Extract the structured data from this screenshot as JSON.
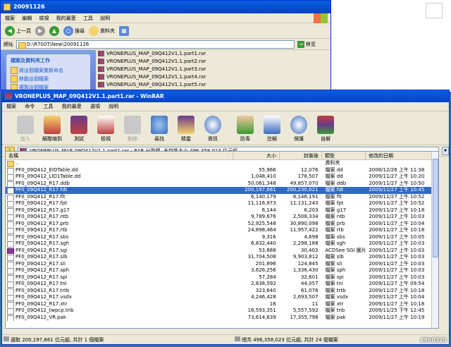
{
  "explorer": {
    "title": "20091126",
    "menu": [
      "檔案",
      "編輯",
      "檢視",
      "我的最愛",
      "工具",
      "說明"
    ],
    "back_label": "上一頁",
    "search_label": "搜尋",
    "folders_label": "資料夾",
    "address_label": "網址",
    "address": "D:\\R700T\\New\\20091126",
    "go_label": "移至",
    "task_title": "檔案及資料夾工作",
    "tasks": [
      "將這個檔案重新命名",
      "移動這個檔案",
      "複製這個檔案"
    ],
    "files": [
      "VRONEPLUS_MAP_09Q412V1.1.part1.rar",
      "VRONEPLUS_MAP_09Q412V1.1.part2.rar",
      "VRONEPLUS_MAP_09Q412V1.1.part3.rar",
      "VRONEPLUS_MAP_09Q412V1.1.part4.rar",
      "VRONEPLUS_MAP_09Q412V1.1.part5.rar"
    ]
  },
  "winrar": {
    "title": "VRONEPLUS_MAP_09Q412V1.1.part1.rar - WinRAR",
    "menu": [
      "檔案",
      "命令",
      "工具",
      "我的最愛",
      "選項",
      "說明"
    ],
    "toolbar": [
      "加入",
      "解壓縮到",
      "測試",
      "檢視",
      "刪除",
      "尋找",
      "精靈",
      "資訊",
      "防毒",
      "註解",
      "保護",
      "自解"
    ],
    "path": "VRONEPLUS_MAP_09Q412V1.1.part1.rar - RAR 分割檔, 未封裝大小 496,358,023 位元組",
    "columns": [
      "名稱",
      "大小",
      "封裝後",
      "類型",
      "修改的日期"
    ],
    "rows": [
      [
        "..",
        "",
        "",
        "資料夾",
        ""
      ],
      [
        "PF0_09Q412_EIDTable.dd",
        "55,966",
        "12,076",
        "檔案 dd",
        "2008/12/26 上午 11:38"
      ],
      [
        "PF0_09Q412_LID1Table.dd",
        "1,048,410",
        "178,507",
        "檔案 dd",
        "2009/11/27 上午 10:20"
      ],
      [
        "PF0_09Q412_R17.ddb",
        "50,061,348",
        "49,857,070",
        "檔案 ddb",
        "2009/11/27 上午 10:50"
      ],
      [
        "PF0_09Q412_R17.fdt",
        "200,197,661",
        "200,230,621",
        "檔案 fdt",
        "2009/11/27 上午 10:45"
      ],
      [
        "PF0_09Q412_R17.flt",
        "6,140,179",
        "6,146,191",
        "檔案 flt",
        "2009/11/27 上午 10:52"
      ],
      [
        "PF0_09Q412_R17.fpt",
        "11,116,973",
        "11,131,243",
        "檔案 fpt",
        "2009/11/27 上午 10:52"
      ],
      [
        "PF0_09Q412_R17.g17",
        "6,144",
        "6,203",
        "檔案 g17",
        "2009/11/27 上午 10:18"
      ],
      [
        "PF0_09Q412_R17.ntb",
        "9,789,676",
        "2,508,334",
        "檔案 ntb",
        "2009/11/27 上午 10:03"
      ],
      [
        "PF0_09Q412_R17.prb",
        "52,925,548",
        "30,890,098",
        "檔案 prb",
        "2009/11/27 上午 10:04"
      ],
      [
        "PF0_09Q412_R17.rtb",
        "24,898,464",
        "11,957,422",
        "檔案 rtb",
        "2009/11/27 上午 10:18"
      ],
      [
        "PF0_09Q412_R17.sbs",
        "9,316",
        "4,698",
        "檔案 sbs",
        "2009/11/27 上午 10:05"
      ],
      [
        "PF0_09Q412_R17.sgh",
        "6,832,440",
        "2,298,188",
        "檔案 sgh",
        "2009/11/27 上午 10:03"
      ],
      [
        "PF0_09Q412_R17.sgi",
        "53,888",
        "30,403",
        "ACDSee SGI 圖片",
        "2009/11/27 上午 10:03"
      ],
      [
        "PF0_09Q412_R17.slb",
        "31,704,508",
        "9,903,812",
        "檔案 slb",
        "2009/11/27 上午 10:03"
      ],
      [
        "PF0_09Q412_R17.sli",
        "201,896",
        "124,845",
        "檔案 sli",
        "2009/11/27 上午 10:03"
      ],
      [
        "PF0_09Q412_R17.sph",
        "3,626,256",
        "1,336,430",
        "檔案 sph",
        "2009/11/27 上午 10:03"
      ],
      [
        "PF0_09Q412_R17.spi",
        "57,284",
        "32,601",
        "檔案 spi",
        "2009/11/27 上午 10:03"
      ],
      [
        "PF0_09Q412_R17.tni",
        "2,838,592",
        "44,057",
        "檔案 tni",
        "2009/11/27 上午 09:54"
      ],
      [
        "PF0_09Q412_R17.trtb",
        "323,640",
        "61,076",
        "檔案 trtb",
        "2009/11/27 上午 10:18"
      ],
      [
        "PF0_09Q412_R17.vsdx",
        "4,246,428",
        "2,693,507",
        "檔案 vsdx",
        "2009/11/27 上午 10:04"
      ],
      [
        "PF0_09Q412_R17.xtr",
        "16",
        "11",
        "檔案 xtr",
        "2009/11/27 上午 10:18"
      ],
      [
        "PF0_09Q412_twpcp.tnb",
        "16,593,351",
        "5,557,592",
        "檔案 tnb",
        "2009/11/25 下午 12:45"
      ],
      [
        "PF0_09Q412_VR.pak",
        "73,614,639",
        "17,355,798",
        "檔案 pak",
        "2009/11/27 上午 10:19"
      ]
    ],
    "selected_row": 4,
    "status_left": "選取 200,197,661 位元組, 共計 1 個檔案",
    "status_right": "總共 496,358,023 位元組, 共計 24 個檔案"
  },
  "watermark": "#960329"
}
